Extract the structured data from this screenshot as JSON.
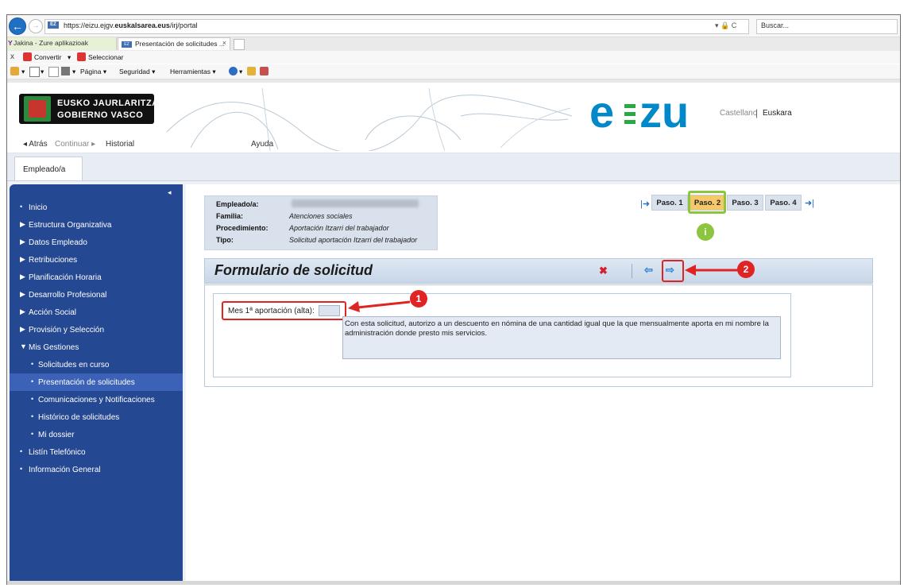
{
  "browser": {
    "url_prefix": "https://eizu.ejgv.",
    "url_domain": "euskalsarea.eus",
    "url_path": "/irj/portal",
    "url_tools": "▾ 🔒 C",
    "search_placeholder": "Buscar...",
    "tabs": [
      {
        "label": "Jakina - Zure aplikazioak"
      },
      {
        "label": "Presentación de solicitudes ..."
      }
    ],
    "toolbar1": {
      "close": "x",
      "convert": "Convertir",
      "select": "Seleccionar"
    },
    "toolbar2": {
      "page": "Página",
      "security": "Seguridad",
      "tools": "Herramientas"
    }
  },
  "header": {
    "logo_line1": "EUSKO JAURLARITZA",
    "logo_line2": "GOBIERNO VASCO",
    "brand_e": "e",
    "brand_zu": "zu",
    "lang_castellano": "Castellano",
    "lang_sep": "|",
    "lang_euskara": "Euskara",
    "nav_back": "◂ Atrás",
    "nav_continue": "Continuar ▸",
    "nav_history": "Historial",
    "nav_help": "Ayuda"
  },
  "role_tab": "Empleado/a",
  "sidebar": {
    "collapse": "◂",
    "items": [
      {
        "label": "Inicio",
        "bullet": "•"
      },
      {
        "label": "Estructura Organizativa",
        "bullet": "▶"
      },
      {
        "label": "Datos Empleado",
        "bullet": "▶"
      },
      {
        "label": "Retribuciones",
        "bullet": "▶"
      },
      {
        "label": "Planificación Horaria",
        "bullet": "▶"
      },
      {
        "label": "Desarrollo Profesional",
        "bullet": "▶"
      },
      {
        "label": "Acción Social",
        "bullet": "▶"
      },
      {
        "label": "Provisión y Selección",
        "bullet": "▶"
      },
      {
        "label": "Mis Gestiones",
        "bullet": "▼"
      },
      {
        "label": "Solicitudes en curso",
        "bullet": "•"
      },
      {
        "label": "Presentación de solicitudes",
        "bullet": "•"
      },
      {
        "label": "Comunicaciones y Notificaciones",
        "bullet": "•"
      },
      {
        "label": "Histórico de solicitudes",
        "bullet": "•"
      },
      {
        "label": "Mi dossier",
        "bullet": "•"
      },
      {
        "label": "Listín Telefónico",
        "bullet": "•"
      },
      {
        "label": "Información General",
        "bullet": "•"
      }
    ]
  },
  "info": {
    "employee_label": "Empleado/a:",
    "family_label": "Familia:",
    "family_value": "Atenciones sociales",
    "procedure_label": "Procedimiento:",
    "procedure_value": "Aportación Itzarri del trabajador",
    "type_label": "Tipo:",
    "type_value": "Solicitud aportación Itzarri del trabajador"
  },
  "steps": {
    "first_arrow": "|➜",
    "last_arrow": "➜|",
    "items": [
      "Paso. 1",
      "Paso. 2",
      "Paso. 3",
      "Paso. 4"
    ],
    "info_badge": "i"
  },
  "form": {
    "title": "Formulario de solicitud",
    "delete_icon": "✖",
    "prev_icon": "⇦",
    "next_icon": "⇨",
    "field_label": "Mes 1ª aportación (alta):",
    "consent_text": "Con esta solicitud, autorizo a un descuento en nómina de una cantidad igual que la que mensualmente aporta en mi nombre la administración donde presto mis servicios."
  },
  "annotations": {
    "badge1": "1",
    "badge2": "2"
  },
  "colors": {
    "sidebar": "#254892",
    "brand_blue": "#0088c8",
    "brand_green": "#29a844",
    "annotation_red": "#e02323",
    "active_step": "#f5c86a"
  }
}
